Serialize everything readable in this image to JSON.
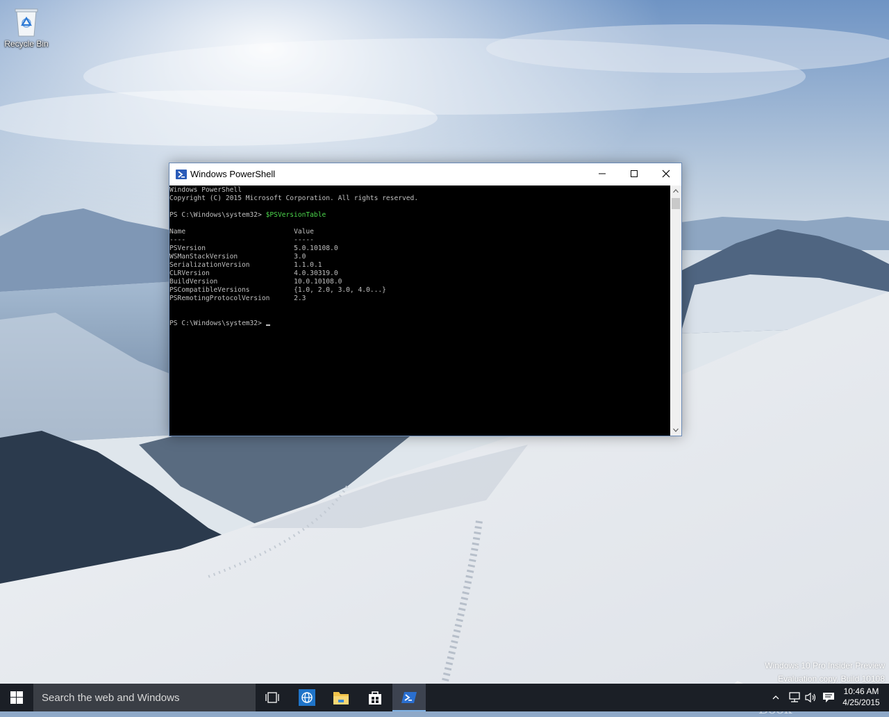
{
  "desktop": {
    "icons": [
      {
        "label": "Recycle Bin",
        "icon": "recycle-bin-icon"
      }
    ],
    "watermark": {
      "line1": "Windows 10 Pro Insider Preview",
      "line2": "Evaluation copy. Build 10108"
    },
    "logo_text": "The Collection Book"
  },
  "window": {
    "title": "Windows PowerShell",
    "icon": "powershell-icon",
    "controls": [
      "minimize-icon",
      "maximize-icon",
      "close-icon"
    ],
    "console": {
      "header1": "Windows PowerShell",
      "header2": "Copyright (C) 2015 Microsoft Corporation. All rights reserved.",
      "prompt": "PS C:\\Windows\\system32> ",
      "command": "$PSVersionTable",
      "table": {
        "columns": [
          "Name",
          "Value"
        ],
        "rule": [
          "----",
          "-----"
        ],
        "rows": [
          [
            "PSVersion",
            "5.0.10108.0"
          ],
          [
            "WSManStackVersion",
            "3.0"
          ],
          [
            "SerializationVersion",
            "1.1.0.1"
          ],
          [
            "CLRVersion",
            "4.0.30319.0"
          ],
          [
            "BuildVersion",
            "10.0.10108.0"
          ],
          [
            "PSCompatibleVersions",
            "{1.0, 2.0, 3.0, 4.0...}"
          ],
          [
            "PSRemotingProtocolVersion",
            "2.3"
          ]
        ]
      },
      "colors": {
        "background": "#000000",
        "text": "#c0c0c0",
        "command": "#4cd84c"
      }
    }
  },
  "taskbar": {
    "search_placeholder": "Search the web and Windows",
    "pinned": [
      "task-view-icon",
      "internet-explorer-icon",
      "file-explorer-icon",
      "store-icon",
      "powershell-icon"
    ],
    "active": "powershell-icon",
    "clock": {
      "time": "10:46 AM",
      "date": "4/25/2015"
    },
    "colors": {
      "background": "#1b1f26",
      "search": "#3a3e45",
      "accent": "#7fb2e5"
    }
  }
}
